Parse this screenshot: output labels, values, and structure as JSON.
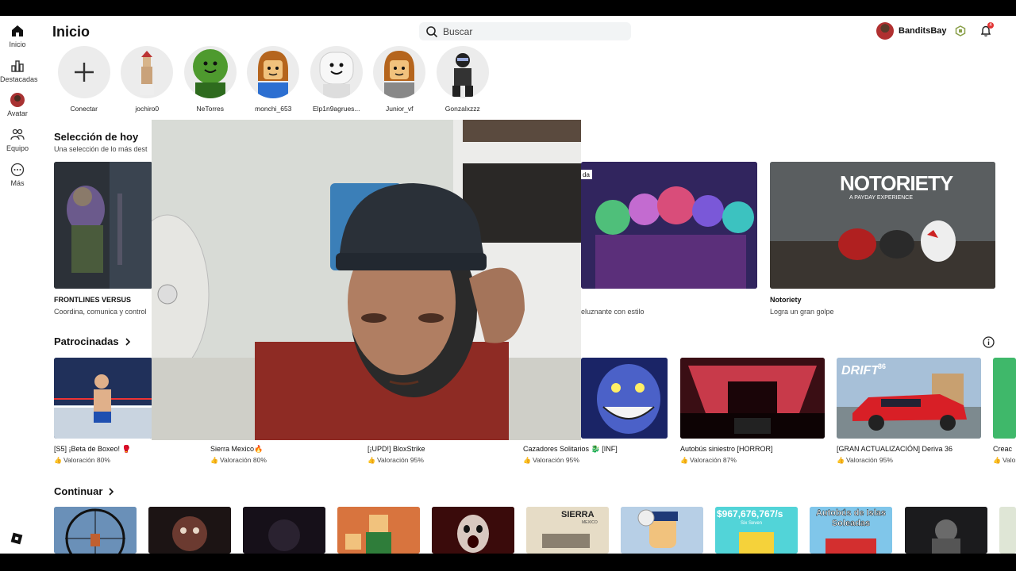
{
  "sidebar": {
    "items": [
      {
        "label": "Inicio",
        "icon": "home-icon"
      },
      {
        "label": "Destacadas",
        "icon": "chart-icon"
      },
      {
        "label": "Avatar",
        "icon": "avatar-icon"
      },
      {
        "label": "Equipo",
        "icon": "team-icon"
      },
      {
        "label": "Más",
        "icon": "more-icon"
      }
    ],
    "bottom_icon": "roblox-logo-icon"
  },
  "header": {
    "title": "Inicio",
    "search_placeholder": "Buscar",
    "username": "BanditsBay",
    "notification_count": "4"
  },
  "friends": [
    {
      "name": "Conectar"
    },
    {
      "name": "jochiro0"
    },
    {
      "name": "NeTorres"
    },
    {
      "name": "monchi_653"
    },
    {
      "name": "Elp1n9agrues..."
    },
    {
      "name": "Junior_vf"
    },
    {
      "name": "Gonzalxzzz"
    }
  ],
  "picks": {
    "title": "Selección de hoy",
    "subtitle": "Una selección de lo más dest",
    "cards": [
      {
        "title": "FRONTLINES VERSUS",
        "desc": "Coordina, comunica y control"
      },
      {
        "title": "",
        "desc": "eluznante con estilo",
        "badge": "da"
      },
      {
        "title": "Notoriety",
        "desc": "Logra un gran golpe",
        "art_text": "NOTORIETY",
        "art_sub": "A PAYDAY EXPERIENCE"
      }
    ]
  },
  "sponsored": {
    "title": "Patrocinadas",
    "games": [
      {
        "name": "[S5] ¡Beta de Boxeo! 🥊",
        "rating": "Valoración 80%"
      },
      {
        "name": "Sierra Mexico🔥",
        "rating": "Valoración 80%"
      },
      {
        "name": "[¡UPD!] BloxStrike",
        "rating": "Valoración 95%"
      },
      {
        "name": "Cazadores Solitarios 🐉 [INF]",
        "rating": "Valoración 95%"
      },
      {
        "name": "Autobús siniestro [HORROR]",
        "rating": "Valoración 87%"
      },
      {
        "name": "[GRAN ACTUALIZACIÓN] Deriva 36",
        "rating": "Valoración 95%",
        "art_text": "DRIFT",
        "art_badge": "36"
      },
      {
        "name": "Creac",
        "rating": "Valor"
      }
    ]
  },
  "continue": {
    "title": "Continuar",
    "tiles": [
      {
        "art_text": ""
      },
      {
        "art_text": ""
      },
      {
        "art_text": ""
      },
      {
        "art_text": ""
      },
      {
        "art_text": ""
      },
      {
        "art_text": "SIERRA",
        "art_sub": "MEXICO"
      },
      {
        "art_text": ""
      },
      {
        "art_text": "$967,676,767/s",
        "art_sub": "Six Seven"
      },
      {
        "art_text": "Autobús de Islas Soleadas"
      },
      {
        "art_text": ""
      }
    ]
  },
  "colors": {
    "accent": "#111111",
    "badge_red": "#e23434",
    "search_bg": "#f2f4f5"
  }
}
